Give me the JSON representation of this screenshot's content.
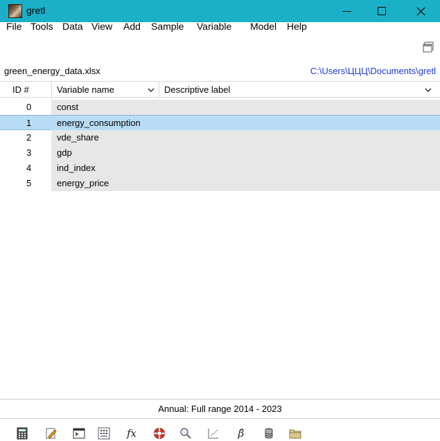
{
  "window": {
    "title": "gretl"
  },
  "menu": {
    "items": [
      "File",
      "Tools",
      "Data",
      "View",
      "Add",
      "Sample",
      "Variable",
      "Model",
      "Help"
    ]
  },
  "dataset": {
    "filename": "green_energy_data.xlsx",
    "path": "C:\\Users\\ЦЦЦ\\Documents\\gretl"
  },
  "columns": {
    "id": "ID #",
    "name": "Variable name",
    "label": "Descriptive label"
  },
  "variables": [
    {
      "id": "0",
      "name": "const"
    },
    {
      "id": "1",
      "name": "energy_consumption"
    },
    {
      "id": "2",
      "name": "vde_share"
    },
    {
      "id": "3",
      "name": "gdp"
    },
    {
      "id": "4",
      "name": "ind_index"
    },
    {
      "id": "5",
      "name": "energy_price"
    }
  ],
  "status": {
    "text": "Annual: Full range 2014 - 2023"
  },
  "toolbar": {
    "icons": [
      "calculator-icon",
      "edit-icon",
      "terminal-icon",
      "matrix-icon",
      "fx-icon",
      "lifebuoy-icon",
      "search-icon",
      "scatter-icon",
      "beta-icon",
      "database-icon",
      "folder-icon"
    ],
    "fx_label": "fx",
    "beta_label": "β̂"
  },
  "selected_row": 1
}
